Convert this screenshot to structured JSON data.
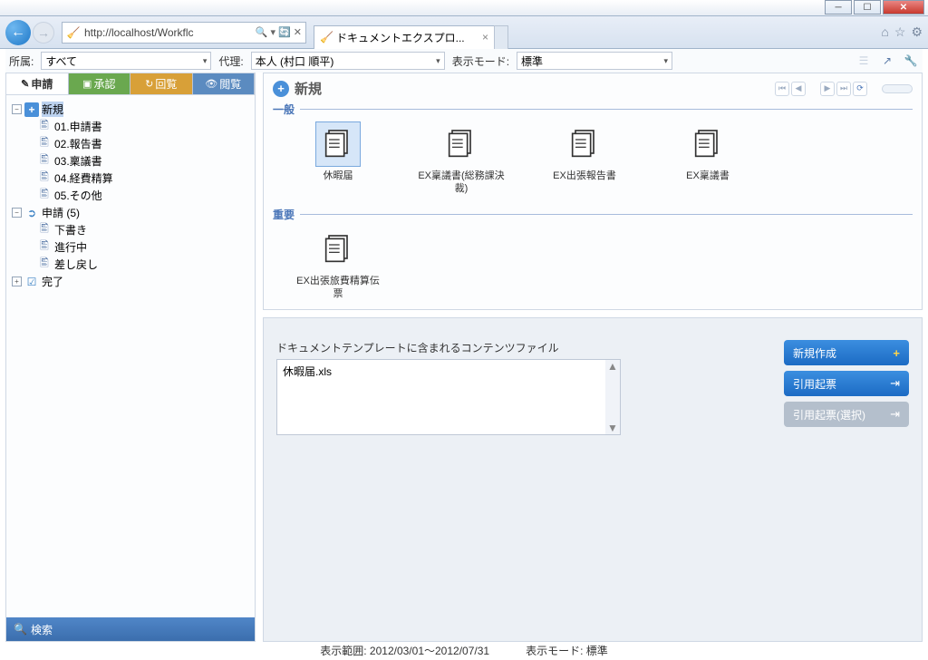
{
  "window": {
    "minimize": "─",
    "maximize": "☐",
    "close": "✕"
  },
  "browser": {
    "url": "http://localhost/Workflc",
    "search_hint": "Search",
    "tab_title": "ドキュメントエクスプロ..."
  },
  "toolbar": {
    "affiliation_label": "所属:",
    "affiliation_value": "すべて",
    "agent_label": "代理:",
    "agent_value": "本人 (村口 順平)",
    "view_mode_label": "表示モード:",
    "view_mode_value": "標準"
  },
  "left_tabs": {
    "apply": "申請",
    "approve": "承認",
    "circulate": "回覧",
    "browse": "閲覧"
  },
  "tree": {
    "new": "新規",
    "items_new": [
      "01.申請書",
      "02.報告書",
      "03.稟議書",
      "04.経費精算",
      "05.その他"
    ],
    "apply": "申請 (5)",
    "items_apply": [
      "下書き",
      "進行中",
      "差し戻し"
    ],
    "complete": "完了"
  },
  "search": {
    "label": "検索"
  },
  "panel": {
    "title": "新規",
    "section_general": "一般",
    "section_important": "重要",
    "docs_general": [
      "休暇届",
      "EX稟議書(総務課決裁)",
      "EX出張報告書",
      "EX稟議書"
    ],
    "docs_important": [
      "EX出張旅費精算伝票"
    ]
  },
  "template": {
    "label": "ドキュメントテンプレートに含まれるコンテンツファイル",
    "item": "休暇届.xls"
  },
  "actions": {
    "new": "新規作成",
    "cite": "引用起票",
    "cite_select": "引用起票(選択)"
  },
  "footer": {
    "range": "表示範囲: 2012/03/01～2012/07/31",
    "mode": "表示モード: 標準"
  }
}
